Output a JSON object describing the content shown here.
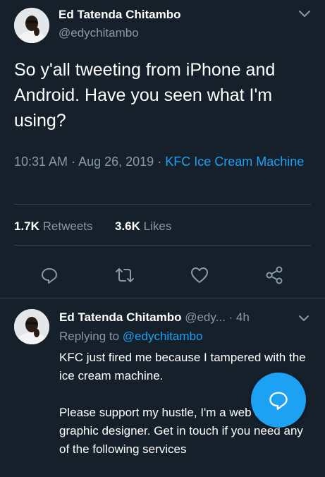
{
  "tweet": {
    "author_name": "Ed Tatenda Chitambo",
    "author_handle": "@edychitambo",
    "text": "So y'all tweeting from iPhone and Android. Have you seen what I'm using?",
    "time": "10:31 AM",
    "date": "Aug 26, 2019",
    "source": "KFC Ice Cream Machine",
    "retweet_count": "1.7K",
    "retweet_label": "Retweets",
    "like_count": "3.6K",
    "like_label": "Likes"
  },
  "actions": [
    "reply-icon",
    "retweet-icon",
    "like-icon",
    "share-icon"
  ],
  "reply": {
    "author_name": "Ed Tatenda Chitambo",
    "author_handle": "@edy...",
    "age": "4h",
    "replying_prefix": "Replying to",
    "replying_to": "@edychitambo",
    "para1": "KFC just fired me because I tampered with the ice cream machine.",
    "para2": "Please support my hustle, I'm a web and graphic designer. Get in touch if you need any of the following services"
  },
  "colors": {
    "background": "#15202b",
    "accent": "#1da1f2",
    "secondary_text": "#8899a6",
    "divider": "#38444d"
  }
}
